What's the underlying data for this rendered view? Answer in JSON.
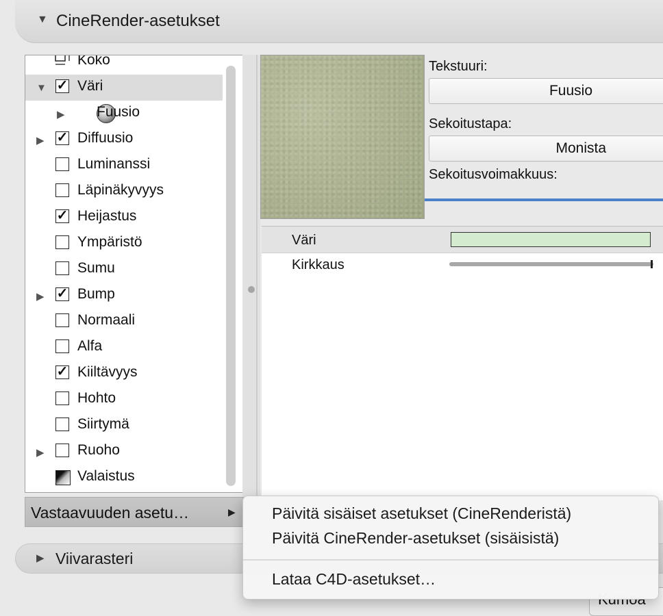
{
  "section": {
    "title": "CineRender-asetukset"
  },
  "tree": {
    "items": [
      {
        "label": "Koko",
        "icon": "resize-icon",
        "disclosure": false,
        "checkbox": null
      },
      {
        "label": "Väri",
        "icon": null,
        "disclosure": "expanded",
        "checkbox": true,
        "selected": true
      },
      {
        "label": "Fuusio",
        "icon": "sphere-icon",
        "disclosure": "collapsed",
        "checkbox": null
      },
      {
        "label": "Diffuusio",
        "icon": null,
        "disclosure": "collapsed",
        "checkbox": true
      },
      {
        "label": "Luminanssi",
        "icon": null,
        "disclosure": false,
        "checkbox": false
      },
      {
        "label": "Läpinäkyvyys",
        "icon": null,
        "disclosure": false,
        "checkbox": false
      },
      {
        "label": "Heijastus",
        "icon": null,
        "disclosure": false,
        "checkbox": true
      },
      {
        "label": "Ympäristö",
        "icon": null,
        "disclosure": false,
        "checkbox": false
      },
      {
        "label": "Sumu",
        "icon": null,
        "disclosure": false,
        "checkbox": false
      },
      {
        "label": "Bump",
        "icon": null,
        "disclosure": "collapsed",
        "checkbox": true
      },
      {
        "label": "Normaali",
        "icon": null,
        "disclosure": false,
        "checkbox": false
      },
      {
        "label": "Alfa",
        "icon": null,
        "disclosure": false,
        "checkbox": false
      },
      {
        "label": "Kiiltävyys",
        "icon": null,
        "disclosure": false,
        "checkbox": true
      },
      {
        "label": "Hohto",
        "icon": null,
        "disclosure": false,
        "checkbox": false
      },
      {
        "label": "Siirtymä",
        "icon": null,
        "disclosure": false,
        "checkbox": false
      },
      {
        "label": "Ruoho",
        "icon": null,
        "disclosure": "collapsed",
        "checkbox": false
      },
      {
        "label": "Valaistus",
        "icon": "lighting-icon",
        "disclosure": false,
        "checkbox": null
      }
    ]
  },
  "texture": {
    "label": "Tekstuuri:",
    "value": "Fuusio",
    "blend_mode_label": "Sekoitustapa:",
    "blend_mode_value": "Monista",
    "blend_strength_label": "Sekoitusvoimakkuus:"
  },
  "properties": {
    "color_label": "Väri",
    "color_value": "#d4ebd0",
    "brightness_label": "Kirkkaus"
  },
  "correspondence_button": {
    "label": "Vastaavuuden asetu…"
  },
  "context_menu": {
    "items": [
      "Päivitä sisäiset asetukset (CineRenderistä)",
      "Päivitä CineRender-asetukset (sisäisistä)",
      "Lataa C4D-asetukset…"
    ]
  },
  "section2": {
    "title": "Viivarasteri"
  },
  "undo_button": {
    "label": "Kumoa"
  }
}
